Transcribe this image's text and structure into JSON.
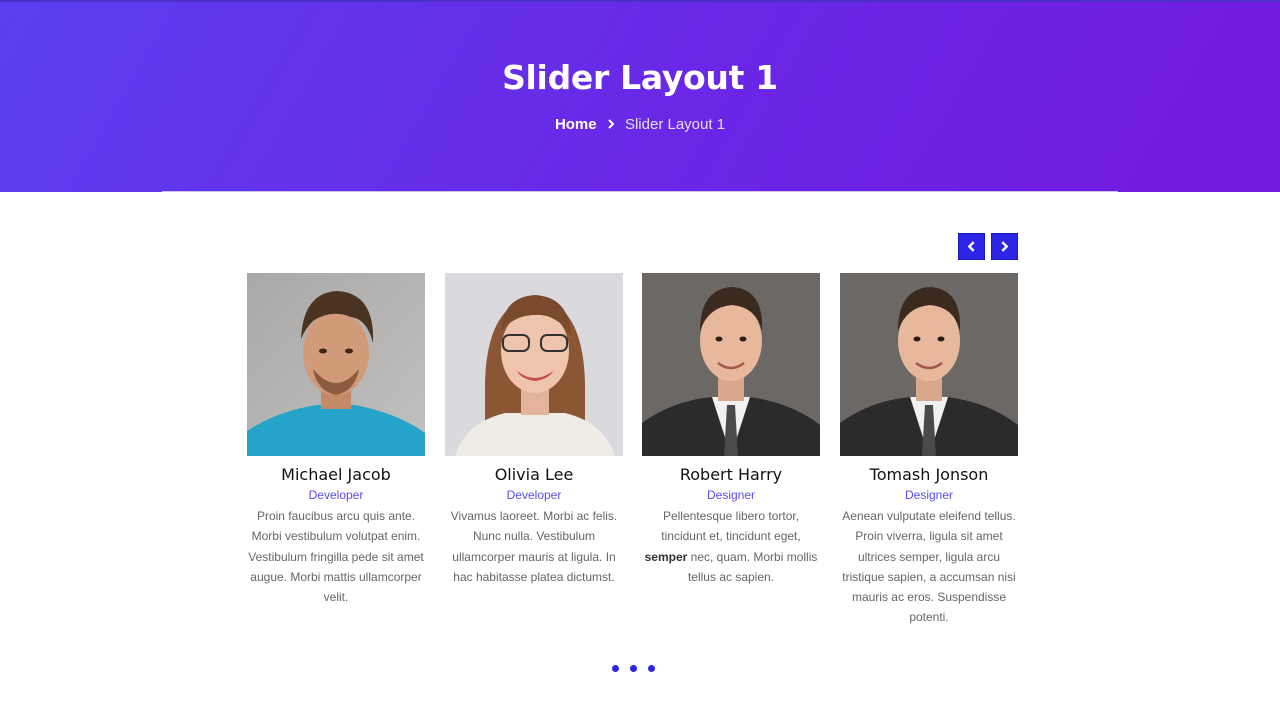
{
  "hero": {
    "title": "Slider Layout 1",
    "breadcrumb_home": "Home",
    "breadcrumb_current": "Slider Layout 1"
  },
  "slider": {
    "prev_icon": "chevron-left-icon",
    "next_icon": "chevron-right-icon",
    "cards": [
      {
        "name": "Michael Jacob",
        "role": "Developer",
        "bio": "Proin faucibus arcu quis ante. Morbi vestibulum volutpat enim. Vestibulum fringilla pede sit amet augue. Morbi mattis ullamcorper velit."
      },
      {
        "name": "Olivia Lee",
        "role": "Developer",
        "bio": "Vivamus laoreet. Morbi ac felis. Nunc nulla. Vestibulum ullamcorper mauris at ligula. In hac habitasse platea dictumst."
      },
      {
        "name": "Robert Harry",
        "role": "Designer",
        "bio_before": "Pellentesque libero tortor, tincidunt et, tincidunt eget, ",
        "bio_bold": "semper",
        "bio_after": " nec, quam. Morbi mollis tellus ac sapien."
      },
      {
        "name": "Tomash Jonson",
        "role": "Designer",
        "bio": "Aenean vulputate eleifend tellus. Proin viverra, ligula sit amet ultrices semper, ligula arcu tristique sapien, a accumsan nisi mauris ac eros. Suspendisse potenti."
      }
    ],
    "dots_count": 3
  },
  "colors": {
    "accent": "#2c25e6",
    "role_text": "#5a4de8",
    "hero_gradient_start": "#5b3ef0",
    "hero_gradient_end": "#7219df"
  }
}
